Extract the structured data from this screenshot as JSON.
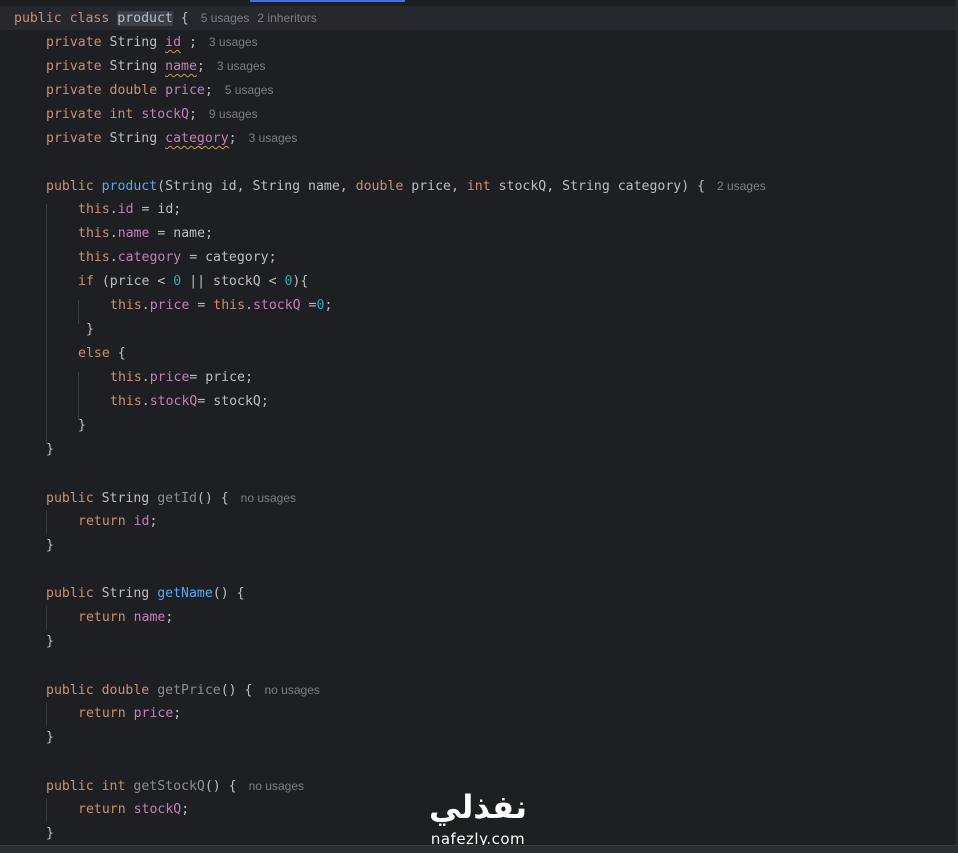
{
  "window": {
    "accent_color": "#3574f0",
    "background": "#1e1f22"
  },
  "class_decl": {
    "kw_public": "public",
    "kw_class": "class",
    "name": "product",
    "brace": " {",
    "usages": "5 usages",
    "inheritors": "2 inheritors"
  },
  "fields": [
    {
      "mod": "private",
      "type": "String",
      "name": "id",
      "suffix": " ;",
      "usages": "3 usages"
    },
    {
      "mod": "private",
      "type": "String",
      "name": "name",
      "suffix": ";",
      "usages": "3 usages"
    },
    {
      "mod": "private",
      "type": "double",
      "name": "price",
      "suffix": ";",
      "usages": "5 usages"
    },
    {
      "mod": "private",
      "type": "int",
      "name": "stockQ",
      "suffix": ";",
      "usages": "9 usages"
    },
    {
      "mod": "private",
      "type": "String",
      "name": "category",
      "suffix": ";",
      "usages": "3 usages"
    }
  ],
  "constructor": {
    "signature_kw": "public",
    "name": "product",
    "params_a": "(String id, String name, ",
    "kw_double": "double",
    "params_b": " price, ",
    "kw_int": "int",
    "params_c": " stockQ, String category) {",
    "usages": "2 usages",
    "body": {
      "this": "this",
      "l1_field": "id",
      "l1_rest": " = id;",
      "l2_field": "name",
      "l2_rest": " = name;",
      "l3_field": "category",
      "l3_rest": " = category;",
      "if_kw": "if",
      "if_a": " (price < ",
      "zero": "0",
      "if_b": " || stockQ < ",
      "if_c": "){",
      "l5_f1": "price",
      "l5_eq": " = ",
      "l5_f2": "stockQ",
      "l5_eq2": " =",
      "l5_end": ";",
      "close_if": "}",
      "else_kw": "else",
      "else_brace": " {",
      "l8_field": "price",
      "l8_rest": "= price;",
      "l9_field": "stockQ",
      "l9_rest": "= stockQ;",
      "close_else": "}",
      "close_ctor": "}"
    }
  },
  "getters": [
    {
      "mod": "public",
      "type": "String",
      "name": "getId",
      "sig_end": "() {",
      "usages": "no usages",
      "ret": "return",
      "field": "id",
      "unused": true
    },
    {
      "mod": "public",
      "type": "String",
      "name": "getName",
      "sig_end": "() {",
      "usages": "",
      "ret": "return",
      "field": "name",
      "unused": false
    },
    {
      "mod": "public",
      "type": "double",
      "name": "getPrice",
      "sig_end": "() {",
      "usages": "no usages",
      "ret": "return",
      "field": "price",
      "unused": true
    },
    {
      "mod": "public",
      "type": "int",
      "name": "getStockQ",
      "sig_end": "() {",
      "usages": "no usages",
      "ret": "return",
      "field": "stockQ",
      "unused": true
    }
  ],
  "semicolon": ";",
  "close_brace": "}",
  "watermark": {
    "arabic": "نفذلي",
    "latin": "nafezly.com"
  }
}
